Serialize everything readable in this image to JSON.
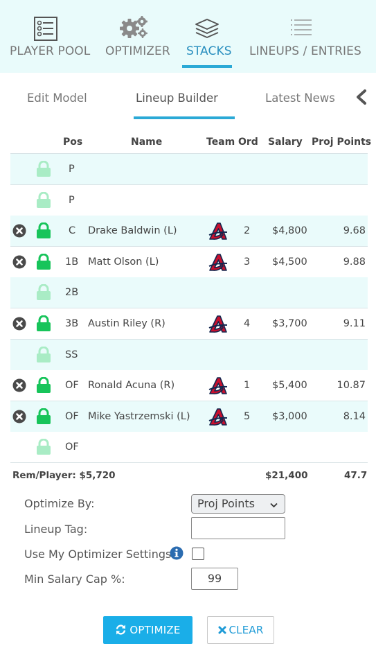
{
  "topnav": {
    "items": [
      {
        "label": "PLAYER POOL",
        "icon": "player-pool-icon",
        "active": false
      },
      {
        "label": "OPTIMIZER",
        "icon": "gears-icon",
        "active": false
      },
      {
        "label": "STACKS",
        "icon": "stacks-icon",
        "active": true
      },
      {
        "label": "LINEUPS / ENTRIES",
        "icon": "lineups-icon",
        "active": false
      }
    ]
  },
  "subtabs": {
    "items": [
      {
        "label": "Edit Model",
        "active": false
      },
      {
        "label": "Lineup Builder",
        "active": true
      },
      {
        "label": "Latest News",
        "active": false
      }
    ]
  },
  "table": {
    "headers": {
      "pos": "Pos",
      "name": "Name",
      "team": "Team",
      "ord": "Ord",
      "salary": "Salary",
      "proj": "Proj Points"
    },
    "rows": [
      {
        "pos": "P",
        "name": "",
        "ord": "",
        "salary": "",
        "proj": "",
        "filled": false
      },
      {
        "pos": "P",
        "name": "",
        "ord": "",
        "salary": "",
        "proj": "",
        "filled": false
      },
      {
        "pos": "C",
        "name": "Drake Baldwin (L)",
        "ord": "2",
        "salary": "$4,800",
        "proj": "9.68",
        "filled": true
      },
      {
        "pos": "1B",
        "name": "Matt Olson (L)",
        "ord": "3",
        "salary": "$4,500",
        "proj": "9.88",
        "filled": true
      },
      {
        "pos": "2B",
        "name": "",
        "ord": "",
        "salary": "",
        "proj": "",
        "filled": false
      },
      {
        "pos": "3B",
        "name": "Austin Riley (R)",
        "ord": "4",
        "salary": "$3,700",
        "proj": "9.11",
        "filled": true
      },
      {
        "pos": "SS",
        "name": "",
        "ord": "",
        "salary": "",
        "proj": "",
        "filled": false
      },
      {
        "pos": "OF",
        "name": "Ronald Acuna (R)",
        "ord": "1",
        "salary": "$5,400",
        "proj": "10.87",
        "filled": true
      },
      {
        "pos": "OF",
        "name": "Mike Yastrzemski (L)",
        "ord": "5",
        "salary": "$3,000",
        "proj": "8.14",
        "filled": true
      },
      {
        "pos": "OF",
        "name": "",
        "ord": "",
        "salary": "",
        "proj": "",
        "filled": false
      }
    ],
    "totals": {
      "rem_player": "Rem/Player: $5,720",
      "salary": "$21,400",
      "proj": "47.7"
    }
  },
  "form": {
    "optimize_by_label": "Optimize By:",
    "optimize_by_value": "Proj Points",
    "lineup_tag_label": "Lineup Tag:",
    "lineup_tag_value": "",
    "use_settings_label": "Use My Optimizer Settings",
    "use_settings_checked": false,
    "min_salary_label": "Min Salary Cap %:",
    "min_salary_value": "99"
  },
  "buttons": {
    "optimize": "OPTIMIZE",
    "clear": "CLEAR"
  },
  "colors": {
    "accent": "#2ba9d6",
    "lock_active": "#17c45a",
    "lock_empty": "#a9ecc5",
    "row_alt": "#eafbfb",
    "braves": "#c8102e"
  }
}
